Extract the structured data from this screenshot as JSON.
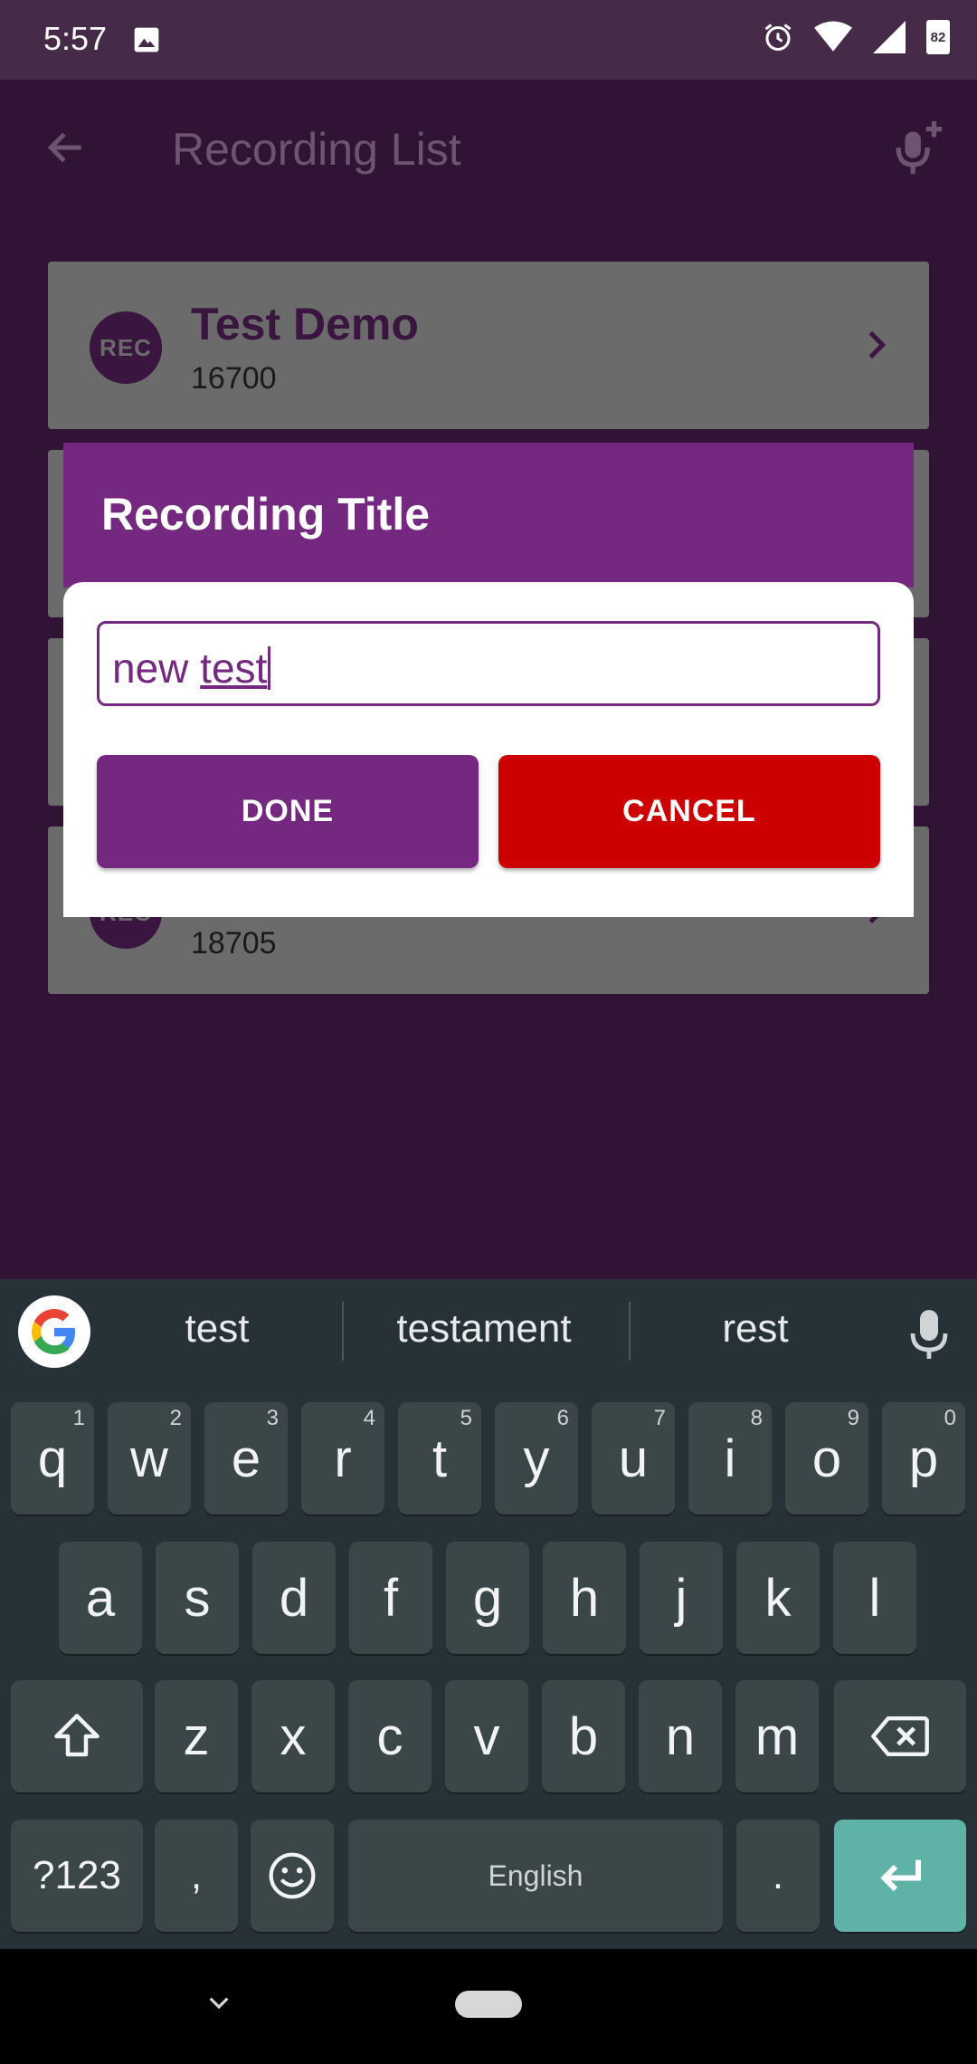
{
  "status_bar": {
    "time": "5:57",
    "battery": "82"
  },
  "app_bar": {
    "title": "Recording List"
  },
  "recordings": [
    {
      "badge": "REC",
      "title": "Test Demo",
      "value": "16700"
    },
    {
      "badge": "REC",
      "title": "",
      "value": "18705"
    }
  ],
  "dialog": {
    "title": "Recording Title",
    "input_prefix": "new ",
    "input_underlined": "test",
    "done_label": "DONE",
    "cancel_label": "CANCEL"
  },
  "keyboard": {
    "suggestions": [
      "test",
      "testament",
      "rest"
    ],
    "row1": [
      {
        "k": "q",
        "s": "1"
      },
      {
        "k": "w",
        "s": "2"
      },
      {
        "k": "e",
        "s": "3"
      },
      {
        "k": "r",
        "s": "4"
      },
      {
        "k": "t",
        "s": "5"
      },
      {
        "k": "y",
        "s": "6"
      },
      {
        "k": "u",
        "s": "7"
      },
      {
        "k": "i",
        "s": "8"
      },
      {
        "k": "o",
        "s": "9"
      },
      {
        "k": "p",
        "s": "0"
      }
    ],
    "row2": [
      "a",
      "s",
      "d",
      "f",
      "g",
      "h",
      "j",
      "k",
      "l"
    ],
    "row3": [
      "z",
      "x",
      "c",
      "v",
      "b",
      "n",
      "m"
    ],
    "symbols_label": "?123",
    "comma": ",",
    "space_label": "English",
    "period": ".",
    "accent_color": "#5fb3a6"
  },
  "colors": {
    "primary": "#74287f",
    "cancel": "#cc0000",
    "background": "#311335"
  }
}
